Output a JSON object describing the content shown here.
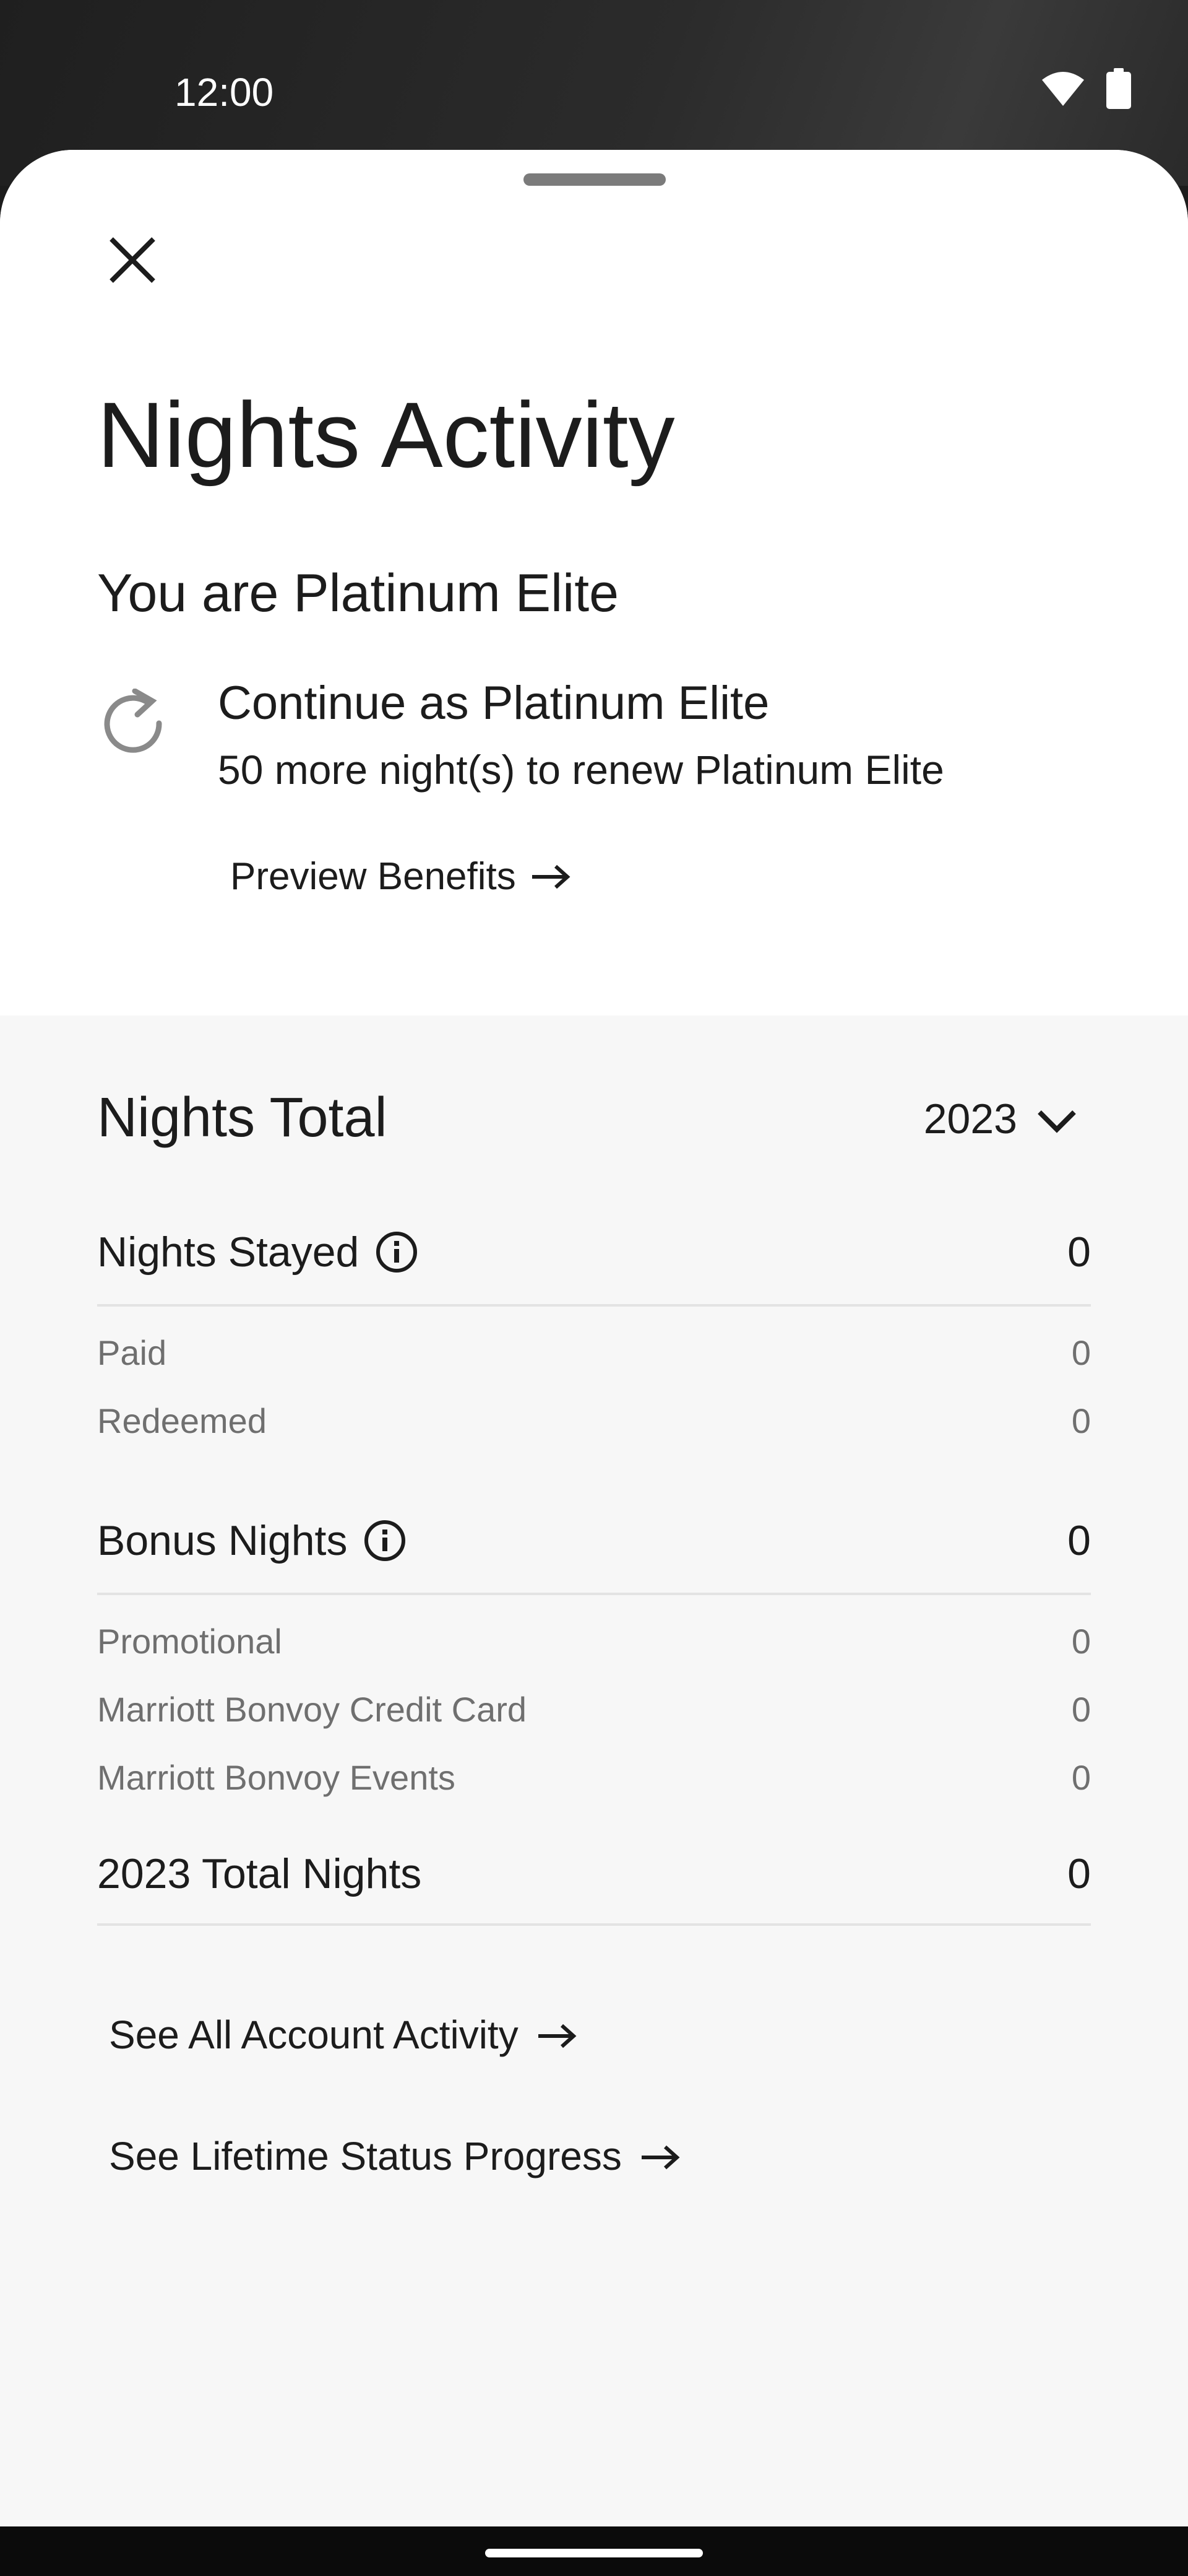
{
  "status_bar": {
    "time": "12:00",
    "wifi_icon": "wifi-icon",
    "battery_icon": "battery-icon"
  },
  "sheet": {
    "close_icon": "close-icon",
    "title": "Nights Activity",
    "tier_heading": "You are Platinum Elite",
    "renewal": {
      "icon": "refresh-icon",
      "title": "Continue as Platinum Elite",
      "subtitle": "50 more night(s) to renew Platinum Elite"
    },
    "preview_link": "Preview Benefits"
  },
  "nights_total": {
    "title": "Nights Total",
    "year": "2023",
    "nights_stayed": {
      "label": "Nights Stayed",
      "value": "0",
      "items": [
        {
          "label": "Paid",
          "value": "0"
        },
        {
          "label": "Redeemed",
          "value": "0"
        }
      ]
    },
    "bonus_nights": {
      "label": "Bonus Nights",
      "value": "0",
      "items": [
        {
          "label": "Promotional",
          "value": "0"
        },
        {
          "label": "Marriott Bonvoy Credit Card",
          "value": "0"
        },
        {
          "label": "Marriott Bonvoy Events",
          "value": "0"
        }
      ]
    },
    "total": {
      "label": "2023 Total Nights",
      "value": "0"
    }
  },
  "links": {
    "account_activity": "See All Account Activity",
    "lifetime_status": "See Lifetime Status Progress"
  }
}
